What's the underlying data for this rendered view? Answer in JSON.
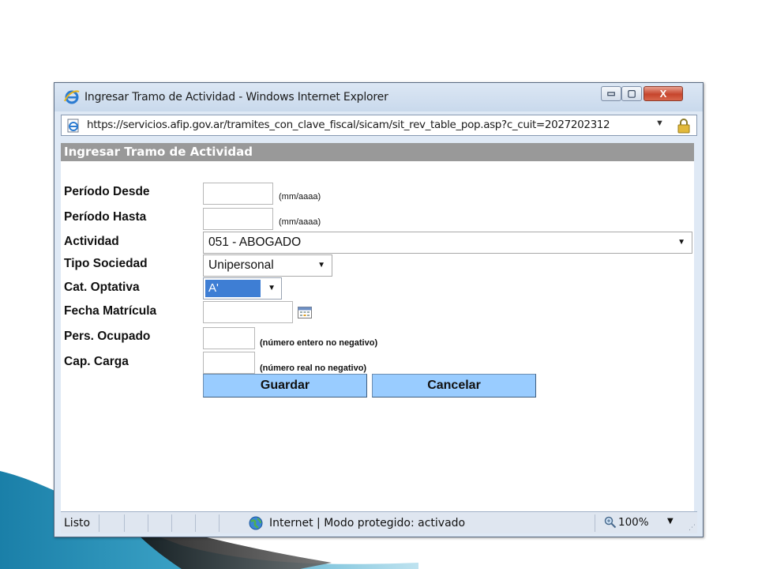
{
  "window": {
    "title": "Ingresar Tramo de Actividad - Windows Internet Explorer",
    "address": "https://servicios.afip.gov.ar/tramites_con_clave_fiscal/sicam/sit_rev_table_pop.asp?c_cuit=2027202312",
    "close_glyph": "X",
    "min_glyph": "▭",
    "max_glyph": "▢",
    "icons": [
      "ie-icon",
      "lock-icon",
      "globe-icon",
      "zoom-icon"
    ]
  },
  "form": {
    "header": "Ingresar Tramo de Actividad",
    "periodo_desde_label": "Período Desde",
    "periodo_desde_hint": "(mm/aaaa)",
    "periodo_hasta_label": "Período Hasta",
    "periodo_hasta_hint": "(mm/aaaa)",
    "actividad_label": "Actividad",
    "actividad_value": "051 - ABOGADO",
    "tipo_sociedad_label": "Tipo Sociedad",
    "tipo_sociedad_value": "Unipersonal",
    "cat_optativa_label": "Cat. Optativa",
    "cat_optativa_value": "A'",
    "fecha_matricula_label": "Fecha Matrícula",
    "pers_ocupado_label": "Pers. Ocupado",
    "pers_ocupado_hint": "(número entero no negativo)",
    "cap_carga_label": "Cap. Carga",
    "cap_carga_hint": "(número real no negativo)",
    "guardar_label": "Guardar",
    "cancelar_label": "Cancelar"
  },
  "status": {
    "left": "Listo",
    "zone": "Internet | Modo protegido: activado",
    "zoom": "100%"
  },
  "colors": {
    "header_bg": "#999999",
    "button_bg": "#99ccff",
    "selected_bg": "#3e7ed4"
  }
}
